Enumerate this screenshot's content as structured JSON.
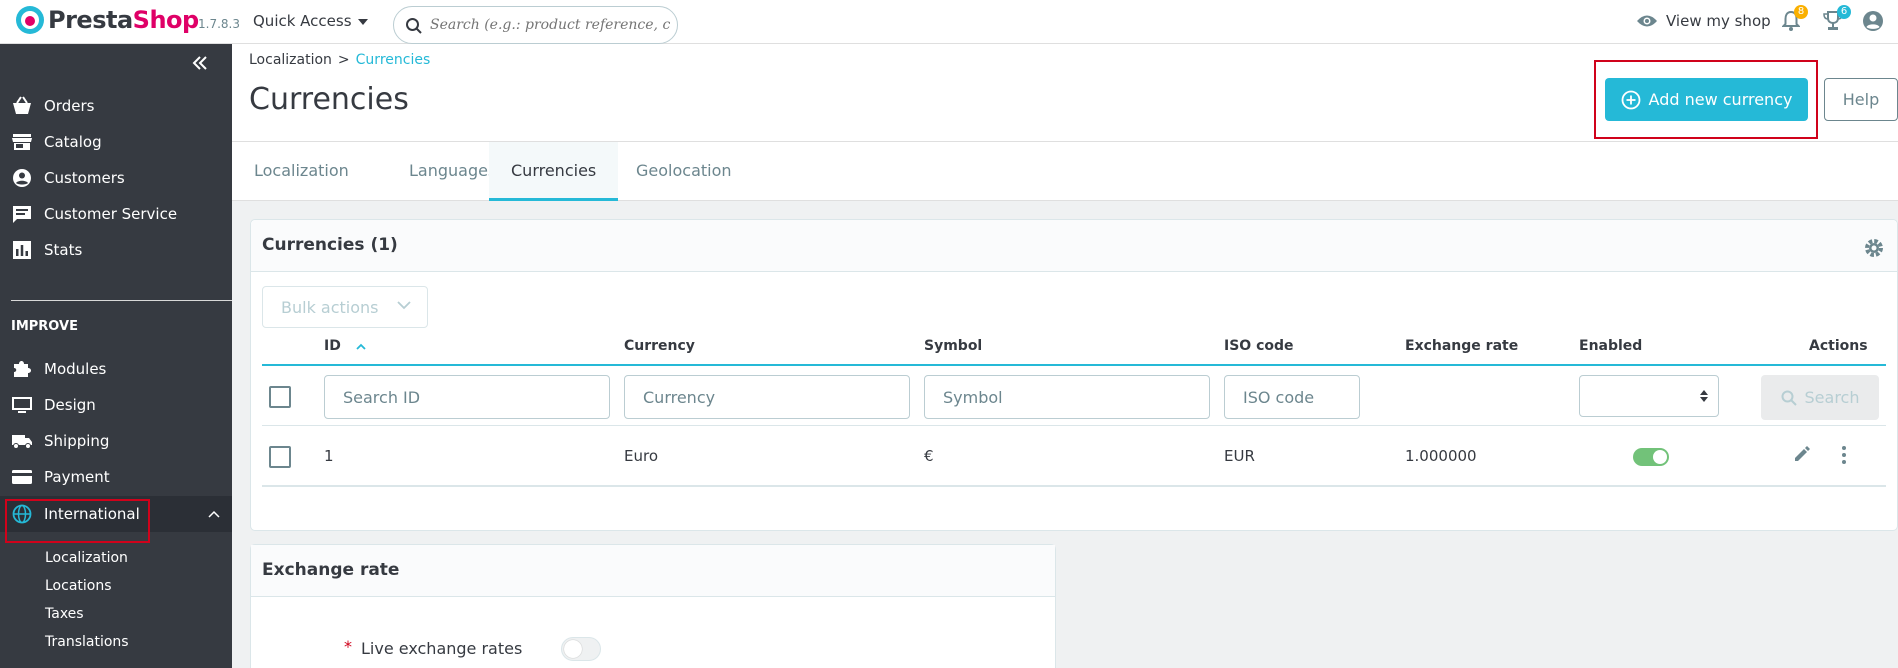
{
  "topbar": {
    "logo_presta": "Presta",
    "logo_shop": "Shop",
    "version": "1.7.8.3",
    "quick_access": "Quick Access",
    "search_placeholder": "Search (e.g.: product reference, custon",
    "view_shop": "View my shop",
    "notifications_count": "8",
    "trophy_count": "6"
  },
  "sidebar": {
    "items": [
      {
        "label": "Orders"
      },
      {
        "label": "Catalog"
      },
      {
        "label": "Customers"
      },
      {
        "label": "Customer Service"
      },
      {
        "label": "Stats"
      }
    ],
    "section_improve": "IMPROVE",
    "improve_items": [
      {
        "label": "Modules"
      },
      {
        "label": "Design"
      },
      {
        "label": "Shipping"
      },
      {
        "label": "Payment"
      },
      {
        "label": "International"
      }
    ],
    "submenu": [
      {
        "label": "Localization"
      },
      {
        "label": "Locations"
      },
      {
        "label": "Taxes"
      },
      {
        "label": "Translations"
      }
    ]
  },
  "header": {
    "breadcrumb_parent": "Localization",
    "breadcrumb_sep": ">",
    "breadcrumb_current": "Currencies",
    "title": "Currencies",
    "add_button": "Add new currency",
    "help_button": "Help"
  },
  "tabs": [
    {
      "label": "Localization"
    },
    {
      "label": "Languages"
    },
    {
      "label": "Currencies"
    },
    {
      "label": "Geolocation"
    }
  ],
  "table": {
    "title": "Currencies (1)",
    "bulk_actions": "Bulk actions",
    "columns": {
      "id": "ID",
      "currency": "Currency",
      "symbol": "Symbol",
      "iso": "ISO code",
      "rate": "Exchange rate",
      "enabled": "Enabled",
      "actions": "Actions"
    },
    "filters": {
      "id": "Search ID",
      "currency": "Currency",
      "symbol": "Symbol",
      "iso": "ISO code"
    },
    "search_button": "Search",
    "rows": [
      {
        "id": "1",
        "currency": "Euro",
        "symbol": "€",
        "iso": "EUR",
        "rate": "1.000000",
        "enabled": true
      }
    ]
  },
  "exchange": {
    "title": "Exchange rate",
    "required_mark": "*",
    "live_label": "Live exchange rates"
  },
  "colors": {
    "accent": "#25b9d7",
    "brand_pink": "#df0067",
    "sidebar_bg": "#363a41",
    "highlight_red": "#d0021b",
    "toggle_on": "#72c279"
  }
}
